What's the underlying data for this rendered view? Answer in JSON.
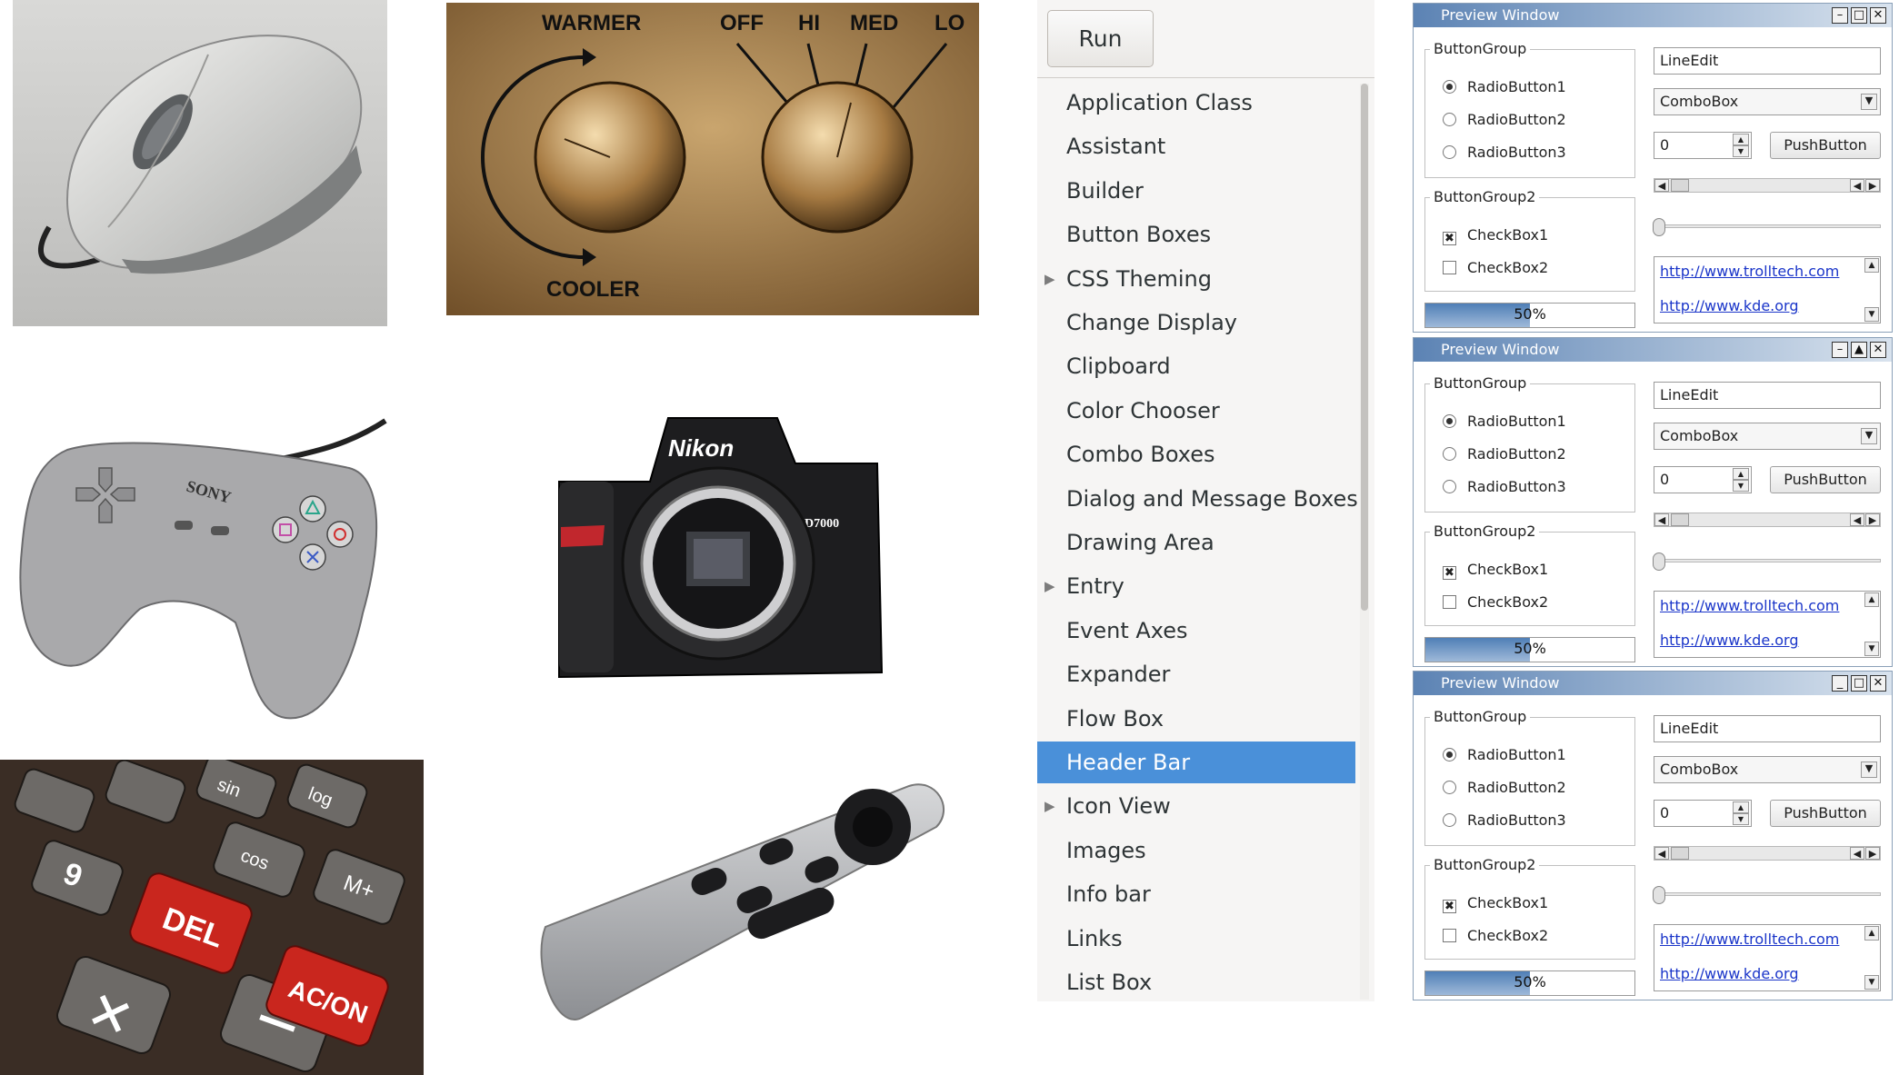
{
  "colors": {
    "gtk_selection": "#4a90d9",
    "qt_title_gradient_start": "#5c83b4",
    "qt_title_gradient_end": "#d9e3ee",
    "link": "#1a35c9",
    "progress_fill": "#4f7fb6"
  },
  "photos": {
    "mouse": {
      "icon": "computer-mouse"
    },
    "thermostat": {
      "icon": "thermostat-knobs",
      "labels": [
        "WARMER",
        "COOLER",
        "OFF",
        "HI",
        "MED",
        "LO"
      ]
    },
    "gamepad": {
      "icon": "game-controller",
      "brand": "SONY"
    },
    "camera": {
      "icon": "dslr-camera",
      "brand": "Nikon",
      "model": "D7000"
    },
    "calculator": {
      "icon": "calculator-keys",
      "keys": [
        "DEL",
        "AC/ON",
        "9",
        "sin",
        "log",
        "cos",
        "M+"
      ]
    },
    "remote": {
      "icon": "tv-remote"
    }
  },
  "gtk_demo": {
    "run_label": "Run",
    "items": [
      {
        "label": "Application Class",
        "expandable": false,
        "selected": false
      },
      {
        "label": "Assistant",
        "expandable": false,
        "selected": false
      },
      {
        "label": "Builder",
        "expandable": false,
        "selected": false
      },
      {
        "label": "Button Boxes",
        "expandable": false,
        "selected": false
      },
      {
        "label": "CSS Theming",
        "expandable": true,
        "selected": false
      },
      {
        "label": "Change Display",
        "expandable": false,
        "selected": false
      },
      {
        "label": "Clipboard",
        "expandable": false,
        "selected": false
      },
      {
        "label": "Color Chooser",
        "expandable": false,
        "selected": false
      },
      {
        "label": "Combo Boxes",
        "expandable": false,
        "selected": false
      },
      {
        "label": "Dialog and Message Boxes",
        "expandable": false,
        "selected": false
      },
      {
        "label": "Drawing Area",
        "expandable": false,
        "selected": false
      },
      {
        "label": "Entry",
        "expandable": true,
        "selected": false
      },
      {
        "label": "Event Axes",
        "expandable": false,
        "selected": false
      },
      {
        "label": "Expander",
        "expandable": false,
        "selected": false
      },
      {
        "label": "Flow Box",
        "expandable": false,
        "selected": false
      },
      {
        "label": "Header Bar",
        "expandable": false,
        "selected": true
      },
      {
        "label": "Icon View",
        "expandable": true,
        "selected": false
      },
      {
        "label": "Images",
        "expandable": false,
        "selected": false
      },
      {
        "label": "Info bar",
        "expandable": false,
        "selected": false
      },
      {
        "label": "Links",
        "expandable": false,
        "selected": false
      },
      {
        "label": "List Box",
        "expandable": false,
        "selected": false
      }
    ]
  },
  "preview_windows": [
    {
      "title": "Preview Window",
      "button_group_label": "ButtonGroup",
      "radios": [
        "RadioButton1",
        "RadioButton2",
        "RadioButton3"
      ],
      "selected_radio": 0,
      "button_group2_label": "ButtonGroup2",
      "checkboxes": [
        {
          "label": "CheckBox1",
          "checked": true
        },
        {
          "label": "CheckBox2",
          "checked": false
        }
      ],
      "line_edit": "LineEdit",
      "combo_box": "ComboBox",
      "spin_value": "0",
      "push_button": "PushButton",
      "links": [
        "http://www.trolltech.com",
        "http://www.kde.org"
      ],
      "progress_text": "50%",
      "progress_value": 0.5,
      "title_buttons": [
        "–",
        "□",
        "✕"
      ]
    },
    {
      "title": "Preview Window",
      "button_group_label": "ButtonGroup",
      "radios": [
        "RadioButton1",
        "RadioButton2",
        "RadioButton3"
      ],
      "selected_radio": 0,
      "button_group2_label": "ButtonGroup2",
      "checkboxes": [
        {
          "label": "CheckBox1",
          "checked": true
        },
        {
          "label": "CheckBox2",
          "checked": false
        }
      ],
      "line_edit": "LineEdit",
      "combo_box": "ComboBox",
      "spin_value": "0",
      "push_button": "PushButton",
      "links": [
        "http://www.trolltech.com",
        "http://www.kde.org"
      ],
      "progress_text": "50%",
      "progress_value": 0.5,
      "title_buttons": [
        "–",
        "▲",
        "✕"
      ]
    },
    {
      "title": "Preview Window",
      "button_group_label": "ButtonGroup",
      "radios": [
        "RadioButton1",
        "RadioButton2",
        "RadioButton3"
      ],
      "selected_radio": 0,
      "button_group2_label": "ButtonGroup2",
      "checkboxes": [
        {
          "label": "CheckBox1",
          "checked": true
        },
        {
          "label": "CheckBox2",
          "checked": false
        }
      ],
      "line_edit": "LineEdit",
      "combo_box": "ComboBox",
      "spin_value": "0",
      "push_button": "PushButton",
      "links": [
        "http://www.trolltech.com",
        "http://www.kde.org"
      ],
      "progress_text": "50%",
      "progress_value": 0.5,
      "title_buttons": [
        "_",
        "□",
        "✕"
      ]
    }
  ]
}
